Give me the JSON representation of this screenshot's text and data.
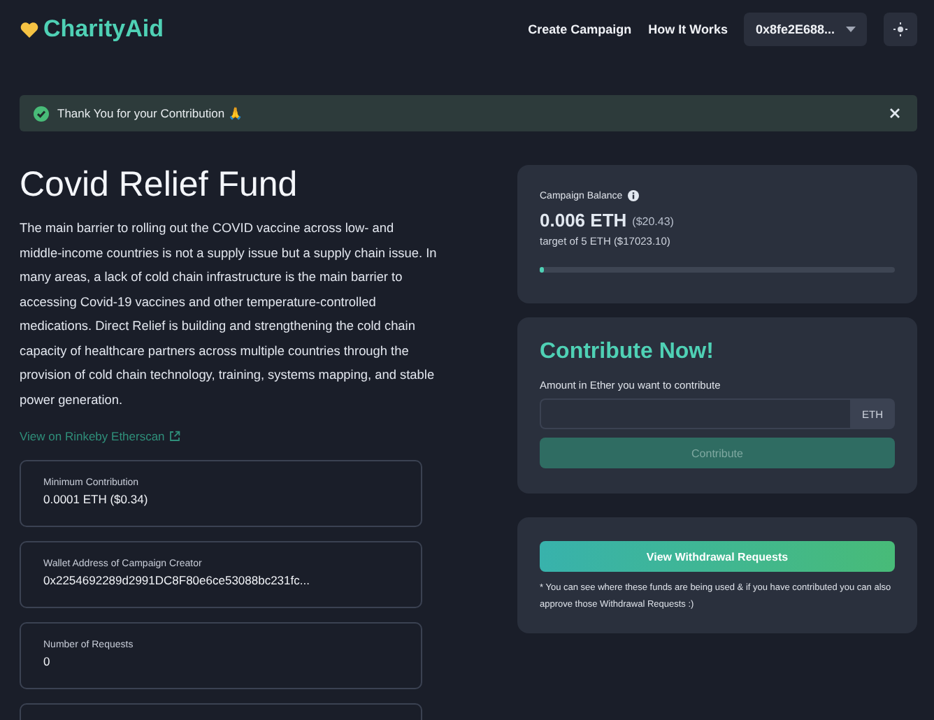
{
  "brand": {
    "name": "CharityAid"
  },
  "nav": {
    "links": [
      "Create Campaign",
      "How It Works"
    ],
    "account": "0x8fe2E688..."
  },
  "alert": {
    "message": "Thank You for your Contribution",
    "emoji": "🙏"
  },
  "campaign": {
    "title": "Covid Relief Fund",
    "description": "The main barrier to rolling out the COVID vaccine across low- and middle-income countries is not a supply issue but a supply chain issue. In many areas, a lack of cold chain infrastructure is the main barrier to accessing Covid-19 vaccines and other temperature-controlled medications. Direct Relief is building and strengthening the cold chain capacity of healthcare partners across multiple countries through the provision of cold chain technology, training, systems mapping, and stable power generation.",
    "link": "View on Rinkeby Etherscan"
  },
  "stats": [
    {
      "label": "Minimum Contribution",
      "value": "0.0001 ETH ($0.34)"
    },
    {
      "label": "Wallet Address of Campaign Creator",
      "value": "0x2254692289d2991DC8F80e6ce53088bc231fc..."
    },
    {
      "label": "Number of Requests",
      "value": "0"
    }
  ],
  "balance": {
    "label": "Campaign Balance",
    "amount": "0.006 ETH",
    "amount_usd": "($20.43)",
    "target": "target of 5 ETH ($17023.10)",
    "level": 0.012
  },
  "contribute": {
    "title": "Contribute Now!",
    "field_label": "Amount in Ether you want to contribute",
    "unit": "ETH",
    "button": "Contribute",
    "disabled": true
  },
  "withdraw": {
    "button": "View Withdrawal Requests",
    "note": "* You can see where these funds are being used & if you have contributed you can also approve those Withdrawal Requests :)"
  }
}
